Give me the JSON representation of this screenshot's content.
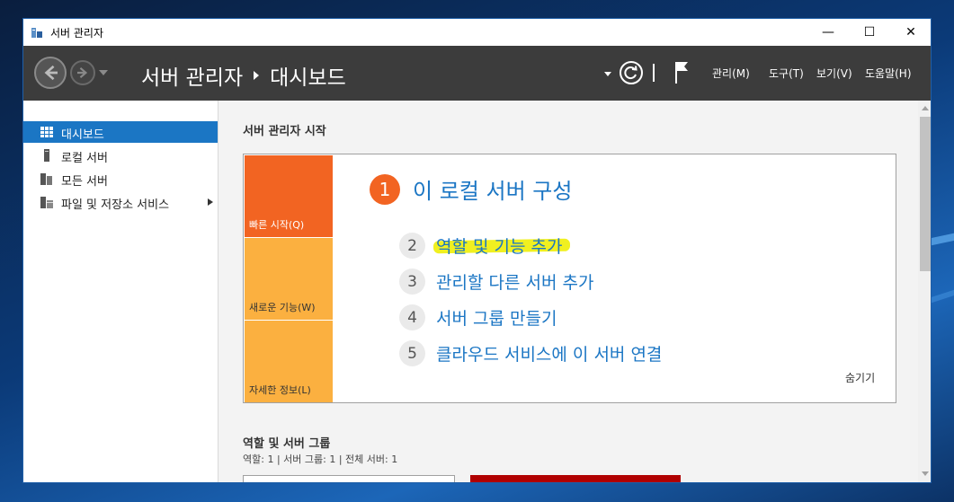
{
  "window": {
    "title": "서버 관리자",
    "buttons": {
      "minimize": "—",
      "maximize": "☐",
      "close": "✕"
    }
  },
  "header": {
    "breadcrumb_root": "서버 관리자",
    "breadcrumb_current": "대시보드",
    "menus": [
      "관리(M)",
      "도구(T)",
      "보기(V)",
      "도움말(H)"
    ]
  },
  "sidebar": {
    "items": [
      {
        "label": "대시보드",
        "icon": "dashboard-icon",
        "active": true
      },
      {
        "label": "로컬 서버",
        "icon": "server-icon",
        "active": false
      },
      {
        "label": "모든 서버",
        "icon": "servers-icon",
        "active": false
      },
      {
        "label": "파일 및 저장소 서비스",
        "icon": "file-storage-icon",
        "active": false,
        "has_submenu": true
      }
    ]
  },
  "main": {
    "section_title": "서버 관리자 시작",
    "tiles": [
      "빠른 시작(Q)",
      "새로운 기능(W)",
      "자세한 정보(L)"
    ],
    "step1": {
      "num": "1",
      "text": "이 로컬 서버 구성"
    },
    "steps": [
      {
        "num": "2",
        "text": "역할 및 기능 추가",
        "highlighted": true
      },
      {
        "num": "3",
        "text": "관리할 다른 서버 추가"
      },
      {
        "num": "4",
        "text": "서버 그룹 만들기"
      },
      {
        "num": "5",
        "text": "클라우드 서비스에 이 서버 연결"
      }
    ],
    "hide_link": "숨기기",
    "roles_title": "역할 및 서버 그룹",
    "roles_counts": "역할: 1   |   서버 그룹: 1   |   전체 서버: 1"
  },
  "colors": {
    "accent": "#1b76c4",
    "tile_primary": "#f26422",
    "tile_secondary": "#fbb040",
    "highlight": "#f0f020",
    "header_bg": "#3c3c3c"
  }
}
